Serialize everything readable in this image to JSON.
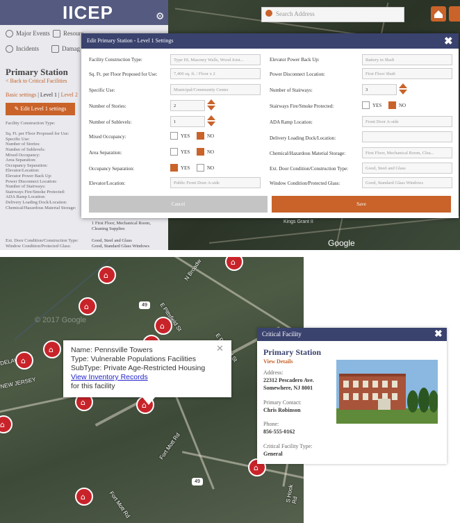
{
  "app": {
    "title": "IICEP"
  },
  "sidebar": {
    "nav": [
      {
        "label": "Major Events"
      },
      {
        "label": "Resourc"
      },
      {
        "label": "Incidents"
      },
      {
        "label": "Damag"
      }
    ],
    "title": "Primary Station",
    "back_link": "< Back to Critical Facilities",
    "tabs": {
      "basic": "Basic settings",
      "sep": "|",
      "level1": "Level 1",
      "level2": "Level 2"
    },
    "edit_button": "Edit Level 1 settings",
    "field_list": [
      "Facility Construction Type:",
      "",
      "Sq. Ft. per Floor Proposed for Use:",
      "Specific Use:",
      "Number of Stories:",
      "Number of Sublevels:",
      "Mixed Occupancy:",
      "Area Separation:",
      "Occupancy Separation:",
      "Elevator/Location:",
      "Elevator Power Back Up:",
      "Power Disconnect Location:",
      "Number of Stairways:",
      "Stairways Fire/Smoke Protected:",
      "ADA Ramp Location:",
      "Delivery Loading Dock/Location:",
      "Chemical/Hazardous Material Storage:"
    ],
    "values_tail": {
      "chemical": "1 First Floor, Mechanical Room,",
      "chemical2": "Cleaning Supplies",
      "ext_door_label": "Ext. Door Condition/Construction Type:",
      "ext_door_val": "Good, Steel and Glass",
      "window_label": "Window Condition/Protected Glass:",
      "window_val": "Good, Standard Glass Windows"
    }
  },
  "search": {
    "placeholder": "Search Address"
  },
  "map1": {
    "place_label": "Kings Grant II",
    "google": "Google"
  },
  "modal": {
    "title": "Edit Primary Station - Level 1 Settings",
    "close": "✖",
    "left": {
      "construction_type": {
        "label": "Facility Construction Type:",
        "placeholder": "Type III, Masonry Walls, Wood Joist..."
      },
      "sqft": {
        "label": "Sq. Ft. per Floor Proposed for Use:",
        "placeholder": "7,400 sq. ft. / Floor x 2"
      },
      "specific_use": {
        "label": "Specific Use:",
        "placeholder": "Municipal/Community Center"
      },
      "stories": {
        "label": "Number of Stories:",
        "value": "2"
      },
      "sublevels": {
        "label": "Number of Sublevels:",
        "value": "1"
      },
      "mixed_occupancy": {
        "label": "Mixed Occupancy:",
        "yes": "YES",
        "no": "NO",
        "selected": "NO"
      },
      "area_separation": {
        "label": "Area Separation:",
        "yes": "YES",
        "no": "NO",
        "selected": "NO"
      },
      "occupancy_separation": {
        "label": "Occupancy Separation:",
        "yes": "YES",
        "no": "NO",
        "selected": "YES"
      },
      "elevator_location": {
        "label": "Elevator/Location:",
        "placeholder": "Public Front Door A-side"
      }
    },
    "right": {
      "elevator_backup": {
        "label": "Elevator Power Back Up:",
        "placeholder": "Battery in Shaft"
      },
      "power_disconnect": {
        "label": "Power Disconnect Location:",
        "placeholder": "First Floor Shaft"
      },
      "stairways": {
        "label": "Number of Stairways:",
        "value": "3"
      },
      "stairways_protected": {
        "label": "Stairways Fire/Smoke Protected:",
        "yes": "YES",
        "no": "NO",
        "selected": "NO"
      },
      "ada_ramp": {
        "label": "ADA Ramp Location:",
        "placeholder": "Front Door A-side"
      },
      "loading_dock": {
        "label": "Delivery Loading Dock/Location:",
        "placeholder": ""
      },
      "chemical": {
        "label": "Chemical/Hazardous Material Storage:",
        "placeholder": "First Floor, Mechanical Room, Clea..."
      },
      "ext_door": {
        "label": "Ext. Door Condition/Construction Type:",
        "placeholder": "Good, Steel and Glass"
      },
      "window": {
        "label": "Window Condition/Protected Glass:",
        "placeholder": "Good, Standard Glass Windows"
      }
    },
    "cancel": "Cancel",
    "save": "Save"
  },
  "map2": {
    "google": "© 2017 Google",
    "road_labels": [
      "N Broadw",
      "E Pittsfield St",
      "E Pittsfield St",
      "NEW JERSEY",
      "DELAW",
      "Fort Mott Rd",
      "Fort Mott Rd",
      "S Hook Rd"
    ],
    "shields": [
      "49",
      "49"
    ],
    "popup": {
      "name": "Name: Pennsville Towers",
      "type": "Type: Vulnerable Populations Facilities",
      "subtype": "SubType: Private Age-Restricted Housing",
      "link": "View Inventory Records",
      "after_link": "for this facility",
      "close": "✕"
    }
  },
  "card": {
    "header": "Critical Facility",
    "close": "✖",
    "name": "Primary Station",
    "view_details": "View Details",
    "address_label": "Address:",
    "address_line1": "22312 Pescadero Ave.",
    "address_line2": "Somewhere, NJ 8001",
    "contact_label": "Primary Contact:",
    "contact": "Chris Robinson",
    "phone_label": "Phone:",
    "phone": "856-555-0162",
    "type_label": "Critical Facility Type:",
    "type": "General"
  },
  "colors": {
    "accent": "#c9632a",
    "header": "#3a426e",
    "pin": "#c9232a"
  }
}
